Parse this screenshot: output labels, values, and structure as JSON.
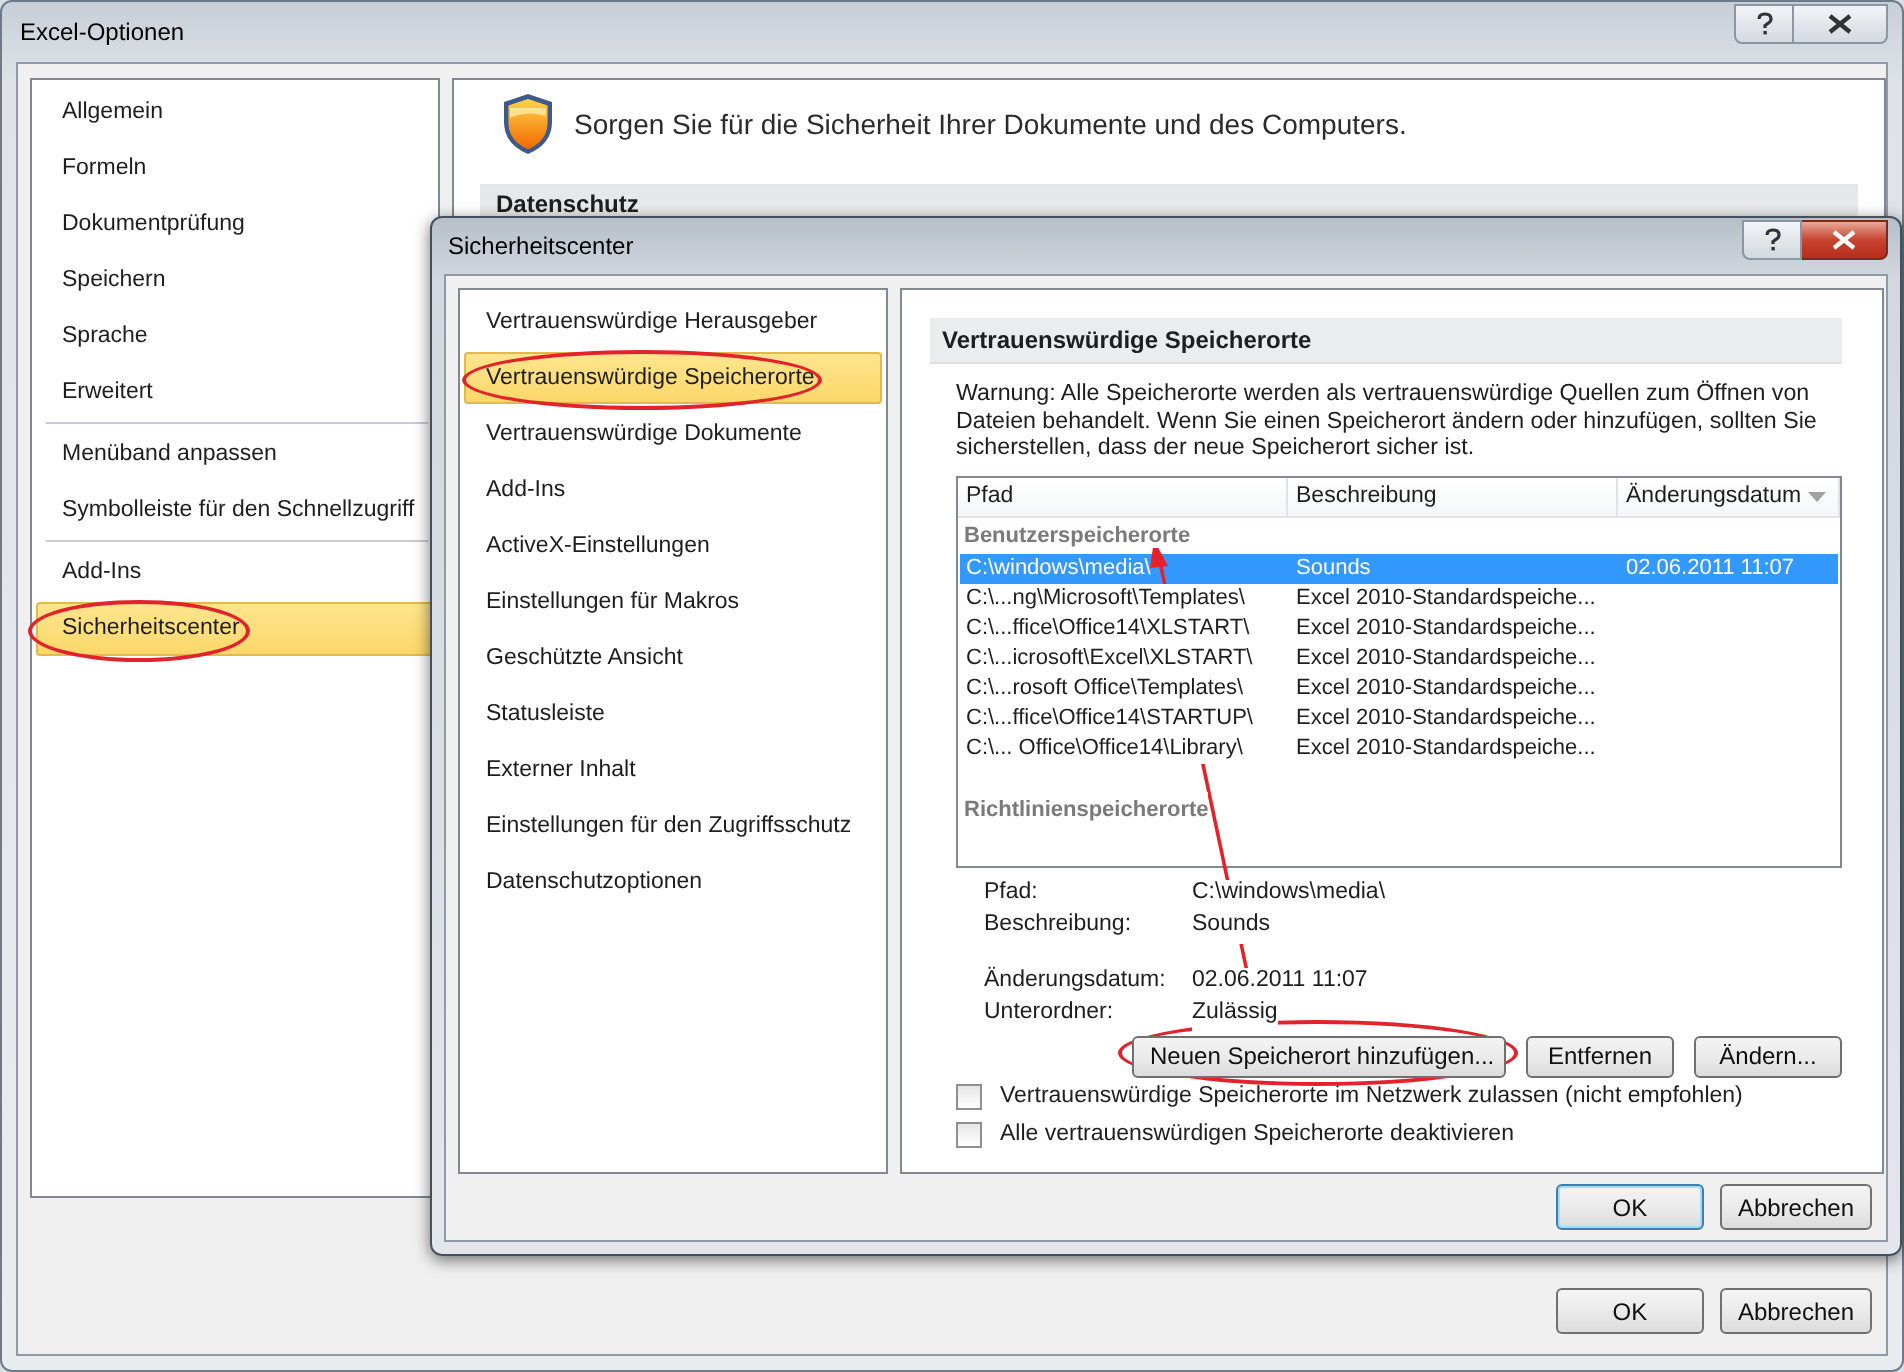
{
  "window": {
    "title": "Excel-Optionen"
  },
  "sidebar": {
    "groups": [
      [
        {
          "label": "Allgemein",
          "selected": false,
          "circled": false
        },
        {
          "label": "Formeln",
          "selected": false,
          "circled": false
        },
        {
          "label": "Dokumentprüfung",
          "selected": false,
          "circled": false
        },
        {
          "label": "Speichern",
          "selected": false,
          "circled": false
        },
        {
          "label": "Sprache",
          "selected": false,
          "circled": false
        },
        {
          "label": "Erweitert",
          "selected": false,
          "circled": false
        }
      ],
      [
        {
          "label": "Menüband anpassen",
          "selected": false,
          "circled": false
        },
        {
          "label": "Symbolleiste für den Schnellzugriff",
          "selected": false,
          "circled": false
        }
      ],
      [
        {
          "label": "Add-Ins",
          "selected": false,
          "circled": false
        },
        {
          "label": "Sicherheitscenter",
          "selected": true,
          "circled": true
        }
      ]
    ]
  },
  "header": {
    "text": "Sorgen Sie für die Sicherheit Ihrer Dokumente und des Computers."
  },
  "section": {
    "title": "Datenschutz"
  },
  "buttons": [
    {
      "label": "OK",
      "default": false
    },
    {
      "label": "Abbrechen",
      "default": false
    }
  ],
  "dialog": {
    "title": "Sicherheitscenter",
    "sidebar": {
      "items": [
        {
          "label": "Vertrauenswürdige Herausgeber",
          "selected": false,
          "circled": false
        },
        {
          "label": "Vertrauenswürdige Speicherorte",
          "selected": true,
          "circled": true
        },
        {
          "label": "Vertrauenswürdige Dokumente",
          "selected": false,
          "circled": false
        },
        {
          "label": "Add-Ins",
          "selected": false,
          "circled": false
        },
        {
          "label": "ActiveX-Einstellungen",
          "selected": false,
          "circled": false
        },
        {
          "label": "Einstellungen für Makros",
          "selected": false,
          "circled": false
        },
        {
          "label": "Geschützte Ansicht",
          "selected": false,
          "circled": false
        },
        {
          "label": "Statusleiste",
          "selected": false,
          "circled": false
        },
        {
          "label": "Externer Inhalt",
          "selected": false,
          "circled": false
        },
        {
          "label": "Einstellungen für den Zugriffsschutz",
          "selected": false,
          "circled": false
        },
        {
          "label": "Datenschutzoptionen",
          "selected": false,
          "circled": false
        }
      ]
    },
    "section_title": "Vertrauenswürdige Speicherorte",
    "warning": "Warnung: Alle Speicherorte werden als vertrauenswürdige Quellen zum Öffnen von Dateien behandelt. Wenn Sie einen Speicherort ändern oder hinzufügen, sollten Sie sicherstellen, dass der neue Speicherort sicher ist.",
    "table": {
      "columns": [
        {
          "label": "Pfad",
          "sorted": false
        },
        {
          "label": "Beschreibung",
          "sorted": false
        },
        {
          "label": "Änderungsdatum",
          "sorted": true
        }
      ],
      "groups": [
        {
          "label": "Benutzerspeicherorte",
          "rows": [
            {
              "cells": [
                "C:\\windows\\media\\",
                "Sounds",
                "02.06.2011 11:07"
              ],
              "selected": true
            },
            {
              "cells": [
                "C:\\...ng\\Microsoft\\Templates\\",
                "Excel 2010-Standardspeiche..."
              ],
              "selected": false
            },
            {
              "cells": [
                "C:\\...ffice\\Office14\\XLSTART\\",
                "Excel 2010-Standardspeiche..."
              ],
              "selected": false
            },
            {
              "cells": [
                "C:\\...icrosoft\\Excel\\XLSTART\\",
                "Excel 2010-Standardspeiche..."
              ],
              "selected": false
            },
            {
              "cells": [
                "C:\\...rosoft Office\\Templates\\",
                "Excel 2010-Standardspeiche..."
              ],
              "selected": false
            },
            {
              "cells": [
                "C:\\...ffice\\Office14\\STARTUP\\",
                "Excel 2010-Standardspeiche..."
              ],
              "selected": false
            },
            {
              "cells": [
                "C:\\... Office\\Office14\\Library\\",
                "Excel 2010-Standardspeiche..."
              ],
              "selected": false
            }
          ]
        },
        {
          "label": "Richtlinienspeicherorte"
        }
      ]
    },
    "details": [
      [
        {
          "label": "Pfad:",
          "value": "C:\\windows\\media\\"
        },
        {
          "label": "Beschreibung:",
          "value": "Sounds"
        }
      ],
      [
        {
          "label": "Änderungsdatum:",
          "value": "02.06.2011 11:07"
        },
        {
          "label": "Unterordner:",
          "value": "Zulässig"
        }
      ]
    ],
    "actions": [
      {
        "label": "Neuen Speicherort hinzufügen...",
        "circled": true
      },
      {
        "label": "Entfernen",
        "circled": false
      },
      {
        "label": "Ändern...",
        "circled": false
      }
    ],
    "options": [
      {
        "label": "Vertrauenswürdige Speicherorte im Netzwerk zulassen (nicht empfohlen)",
        "checked": false
      },
      {
        "label": "Alle vertrauenswürdigen Speicherorte deaktivieren",
        "checked": false
      }
    ],
    "buttons": [
      {
        "label": "OK",
        "default": true
      },
      {
        "label": "Abbrechen",
        "default": false
      }
    ]
  }
}
